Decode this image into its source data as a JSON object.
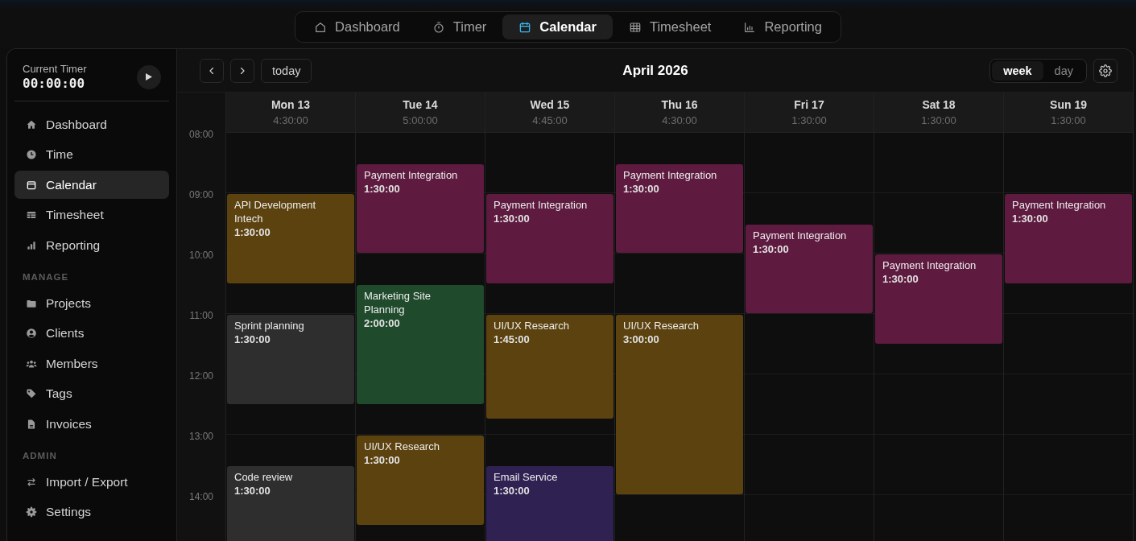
{
  "top_nav": {
    "tabs": [
      {
        "label": "Dashboard",
        "selected": false
      },
      {
        "label": "Timer",
        "selected": false
      },
      {
        "label": "Calendar",
        "selected": true
      },
      {
        "label": "Timesheet",
        "selected": false
      },
      {
        "label": "Reporting",
        "selected": false
      }
    ]
  },
  "sidebar": {
    "timer": {
      "label": "Current Timer",
      "value": "00:00:00"
    },
    "sections": [
      {
        "items": [
          {
            "label": "Dashboard",
            "selected": false
          },
          {
            "label": "Time",
            "selected": false
          },
          {
            "label": "Calendar",
            "selected": true
          },
          {
            "label": "Timesheet",
            "selected": false
          },
          {
            "label": "Reporting",
            "selected": false
          }
        ]
      },
      {
        "heading": "MANAGE",
        "items": [
          {
            "label": "Projects",
            "selected": false
          },
          {
            "label": "Clients",
            "selected": false
          },
          {
            "label": "Members",
            "selected": false
          },
          {
            "label": "Tags",
            "selected": false
          },
          {
            "label": "Invoices",
            "selected": false
          }
        ]
      },
      {
        "heading": "ADMIN",
        "items": [
          {
            "label": "Import / Export",
            "selected": false
          },
          {
            "label": "Settings",
            "selected": false
          }
        ]
      }
    ]
  },
  "calendar": {
    "today_button": "today",
    "title": "April 2026",
    "views": [
      {
        "label": "week",
        "selected": true
      },
      {
        "label": "day",
        "selected": false
      }
    ],
    "hours": [
      "08:00",
      "09:00",
      "10:00",
      "11:00",
      "12:00",
      "13:00",
      "14:00"
    ],
    "days": [
      {
        "name": "Mon 13",
        "total": "4:30:00",
        "timeline": [
          {
            "kind": "gap"
          },
          {
            "kind": "gap"
          },
          {
            "kind": "gap"
          },
          {
            "kind": "gap"
          },
          {
            "kind": "event",
            "title": "API Development Intech",
            "duration": "1:30:00",
            "color": "#5c420f"
          },
          {
            "kind": "gap"
          },
          {
            "kind": "gap"
          },
          {
            "kind": "event",
            "title": "Sprint planning",
            "duration": "1:30:00",
            "color": "#2e2e2e"
          },
          {
            "kind": "gap"
          },
          {
            "kind": "gap"
          },
          {
            "kind": "gap"
          },
          {
            "kind": "gap"
          },
          {
            "kind": "event",
            "title": "Code review",
            "duration": "1:30:00",
            "color": "#2e2e2e"
          }
        ]
      },
      {
        "name": "Tue 14",
        "total": "5:00:00",
        "timeline": [
          {
            "kind": "gap"
          },
          {
            "kind": "gap"
          },
          {
            "kind": "event",
            "title": "Payment Integration",
            "duration": "1:30:00",
            "color": "#5e1a3f"
          },
          {
            "kind": "gap"
          },
          {
            "kind": "gap"
          },
          {
            "kind": "event",
            "title": "Marketing Site Planning",
            "duration": "2:00:00",
            "color": "#1f4a2b"
          },
          {
            "kind": "gap"
          },
          {
            "kind": "gap"
          },
          {
            "kind": "event",
            "title": "UI/UX Research",
            "duration": "1:30:00",
            "color": "#5c420f"
          }
        ]
      },
      {
        "name": "Wed 15",
        "total": "4:45:00",
        "timeline": [
          {
            "kind": "gap"
          },
          {
            "kind": "gap"
          },
          {
            "kind": "gap"
          },
          {
            "kind": "gap"
          },
          {
            "kind": "event",
            "title": "Payment Integration",
            "duration": "1:30:00",
            "color": "#5e1a3f"
          },
          {
            "kind": "gap"
          },
          {
            "kind": "gap"
          },
          {
            "kind": "event",
            "title": "UI/UX Research",
            "duration": "1:45:00",
            "color": "#5c420f"
          },
          {
            "kind": "gap"
          },
          {
            "kind": "gap"
          },
          {
            "kind": "gap"
          },
          {
            "kind": "event",
            "title": "Email Service",
            "duration": "1:30:00",
            "color": "#2f2152"
          }
        ]
      },
      {
        "name": "Thu 16",
        "total": "4:30:00",
        "timeline": [
          {
            "kind": "gap"
          },
          {
            "kind": "gap"
          },
          {
            "kind": "event",
            "title": "Payment Integration",
            "duration": "1:30:00",
            "color": "#5e1a3f"
          },
          {
            "kind": "gap"
          },
          {
            "kind": "gap"
          },
          {
            "kind": "gap"
          },
          {
            "kind": "gap"
          },
          {
            "kind": "event",
            "title": "UI/UX Research",
            "duration": "3:00:00",
            "color": "#5c420f"
          }
        ]
      },
      {
        "name": "Fri 17",
        "total": "1:30:00",
        "timeline": [
          {
            "kind": "gap"
          },
          {
            "kind": "gap"
          },
          {
            "kind": "gap"
          },
          {
            "kind": "gap"
          },
          {
            "kind": "gap"
          },
          {
            "kind": "gap"
          },
          {
            "kind": "event",
            "title": "Payment Integration",
            "duration": "1:30:00",
            "color": "#5e1a3f"
          }
        ]
      },
      {
        "name": "Sat 18",
        "total": "1:30:00",
        "timeline": [
          {
            "kind": "gap"
          },
          {
            "kind": "gap"
          },
          {
            "kind": "gap"
          },
          {
            "kind": "gap"
          },
          {
            "kind": "gap"
          },
          {
            "kind": "gap"
          },
          {
            "kind": "gap"
          },
          {
            "kind": "gap"
          },
          {
            "kind": "event",
            "title": "Payment Integration",
            "duration": "1:30:00",
            "color": "#5e1a3f"
          }
        ]
      },
      {
        "name": "Sun 19",
        "total": "1:30:00",
        "timeline": [
          {
            "kind": "gap"
          },
          {
            "kind": "gap"
          },
          {
            "kind": "gap"
          },
          {
            "kind": "gap"
          },
          {
            "kind": "event",
            "title": "Payment Integration",
            "duration": "1:30:00",
            "color": "#5e1a3f"
          }
        ]
      }
    ]
  }
}
